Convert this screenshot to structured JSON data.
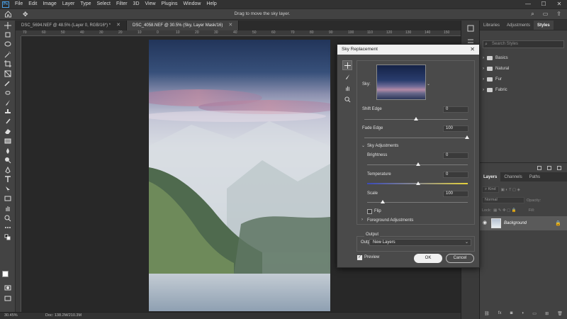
{
  "menu": [
    "File",
    "Edit",
    "Image",
    "Layer",
    "Type",
    "Select",
    "Filter",
    "3D",
    "View",
    "Plugins",
    "Window",
    "Help"
  ],
  "app_logo": "Ps",
  "options_hint": "Drag to move the sky layer.",
  "tabs": [
    {
      "label": "DSC_5694.NEF @ 48.5% (Layer 0, RGB/16*) *"
    },
    {
      "label": "DSC_4058.NEF @ 30.5% (Sky, Layer Mask/16)"
    }
  ],
  "ruler_top": [
    "70",
    "60",
    "50",
    "40",
    "30",
    "20",
    "10",
    "0",
    "10",
    "20",
    "30",
    "40",
    "50",
    "60",
    "70",
    "80",
    "90",
    "100",
    "110",
    "120",
    "130",
    "140",
    "150"
  ],
  "status": {
    "zoom": "30.45%",
    "doc": "Doc: 138.2M/210.3M"
  },
  "right_panel": {
    "tabs": [
      "Libraries",
      "Adjustments",
      "Styles"
    ],
    "search_placeholder": "Search Styles",
    "folders": [
      "Basics",
      "Natural",
      "Fur",
      "Fabric"
    ]
  },
  "layers_panel": {
    "tabs": [
      "Layers",
      "Channels",
      "Paths"
    ],
    "filter": "Kind",
    "blend": "Normal",
    "opacity_label": "Opacity:",
    "lock_label": "Lock:",
    "fill_label": "Fill:",
    "layer_name": "Background"
  },
  "dialog": {
    "title": "Sky Replacement",
    "sky_label": "Sky:",
    "shift_edge": {
      "label": "Shift Edge",
      "value": "0"
    },
    "fade_edge": {
      "label": "Fade Edge",
      "value": "100"
    },
    "sky_adjustments": "Sky Adjustments",
    "brightness": {
      "label": "Brightness",
      "value": "0"
    },
    "temperature": {
      "label": "Temperature",
      "value": "0"
    },
    "scale": {
      "label": "Scale",
      "value": "100"
    },
    "flip": "Flip",
    "foreground_adjustments": "Foreground Adjustments",
    "output_heading": "Output",
    "output_to_label": "Output To:",
    "output_to_value": "New Layers",
    "preview_label": "Preview",
    "ok": "OK",
    "cancel": "Cancel"
  }
}
